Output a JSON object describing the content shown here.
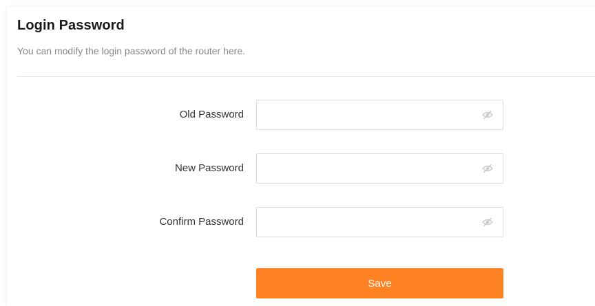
{
  "header": {
    "title": "Login Password",
    "description": "You can modify the login password of the router here."
  },
  "form": {
    "fields": [
      {
        "label": "Old Password",
        "value": "",
        "placeholder": "",
        "icon": "eye-off-icon"
      },
      {
        "label": "New Password",
        "value": "",
        "placeholder": "",
        "icon": "eye-off-icon"
      },
      {
        "label": "Confirm Password",
        "value": "",
        "placeholder": "",
        "icon": "eye-off-icon"
      }
    ],
    "save_label": "Save"
  },
  "colors": {
    "accent": "#ff8222",
    "title_text": "#1a1a1a",
    "description_text": "#888888",
    "label_text": "#333333",
    "input_border": "#dcdcdc",
    "icon": "#c8c8c8"
  }
}
